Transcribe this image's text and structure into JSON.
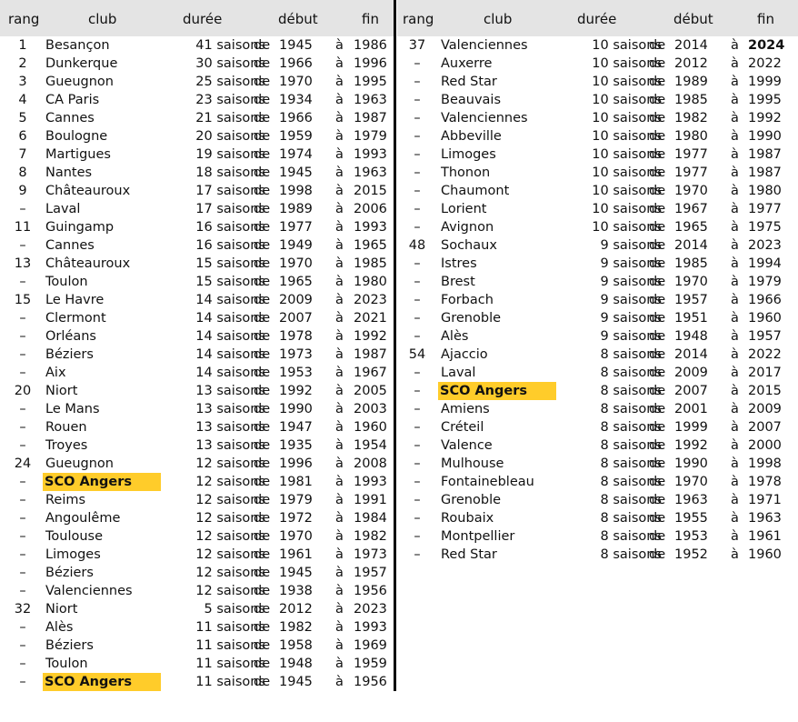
{
  "headers": {
    "rang": "rang",
    "club": "club",
    "duree": "durée",
    "debut": "début",
    "fin": "fin"
  },
  "connectors": {
    "de": "de",
    "a": "à"
  },
  "highlight_color": "#ffcc2a",
  "header_bg": "#e4e4e4",
  "left_rows": [
    {
      "rang": "1",
      "club": "Besançon",
      "duree": "41 saisons",
      "debut": "1945",
      "fin": "1986"
    },
    {
      "rang": "2",
      "club": "Dunkerque",
      "duree": "30 saisons",
      "debut": "1966",
      "fin": "1996"
    },
    {
      "rang": "3",
      "club": "Gueugnon",
      "duree": "25 saisons",
      "debut": "1970",
      "fin": "1995"
    },
    {
      "rang": "4",
      "club": "CA Paris",
      "duree": "23 saisons",
      "debut": "1934",
      "fin": "1963"
    },
    {
      "rang": "5",
      "club": "Cannes",
      "duree": "21 saisons",
      "debut": "1966",
      "fin": "1987"
    },
    {
      "rang": "6",
      "club": "Boulogne",
      "duree": "20 saisons",
      "debut": "1959",
      "fin": "1979"
    },
    {
      "rang": "7",
      "club": "Martigues",
      "duree": "19 saisons",
      "debut": "1974",
      "fin": "1993"
    },
    {
      "rang": "8",
      "club": "Nantes",
      "duree": "18 saisons",
      "debut": "1945",
      "fin": "1963"
    },
    {
      "rang": "9",
      "club": "Châteauroux",
      "duree": "17 saisons",
      "debut": "1998",
      "fin": "2015"
    },
    {
      "rang": "–",
      "club": "Laval",
      "duree": "17 saisons",
      "debut": "1989",
      "fin": "2006"
    },
    {
      "rang": "11",
      "club": "Guingamp",
      "duree": "16 saisons",
      "debut": "1977",
      "fin": "1993"
    },
    {
      "rang": "–",
      "club": "Cannes",
      "duree": "16 saisons",
      "debut": "1949",
      "fin": "1965"
    },
    {
      "rang": "13",
      "club": "Châteauroux",
      "duree": "15 saisons",
      "debut": "1970",
      "fin": "1985"
    },
    {
      "rang": "–",
      "club": "Toulon",
      "duree": "15 saisons",
      "debut": "1965",
      "fin": "1980"
    },
    {
      "rang": "15",
      "club": "Le Havre",
      "duree": "14 saisons",
      "debut": "2009",
      "fin": "2023"
    },
    {
      "rang": "–",
      "club": "Clermont",
      "duree": "14 saisons",
      "debut": "2007",
      "fin": "2021"
    },
    {
      "rang": "–",
      "club": "Orléans",
      "duree": "14 saisons",
      "debut": "1978",
      "fin": "1992"
    },
    {
      "rang": "–",
      "club": "Béziers",
      "duree": "14 saisons",
      "debut": "1973",
      "fin": "1987"
    },
    {
      "rang": "–",
      "club": "Aix",
      "duree": "14 saisons",
      "debut": "1953",
      "fin": "1967"
    },
    {
      "rang": "20",
      "club": "Niort",
      "duree": "13 saisons",
      "debut": "1992",
      "fin": "2005"
    },
    {
      "rang": "–",
      "club": "Le Mans",
      "duree": "13 saisons",
      "debut": "1990",
      "fin": "2003"
    },
    {
      "rang": "–",
      "club": "Rouen",
      "duree": "13 saisons",
      "debut": "1947",
      "fin": "1960"
    },
    {
      "rang": "–",
      "club": "Troyes",
      "duree": "13 saisons",
      "debut": "1935",
      "fin": "1954"
    },
    {
      "rang": "24",
      "club": "Gueugnon",
      "duree": "12 saisons",
      "debut": "1996",
      "fin": "2008"
    },
    {
      "rang": "–",
      "club": "SCO Angers",
      "duree": "12 saisons",
      "debut": "1981",
      "fin": "1993",
      "highlight": true
    },
    {
      "rang": "–",
      "club": "Reims",
      "duree": "12 saisons",
      "debut": "1979",
      "fin": "1991"
    },
    {
      "rang": "–",
      "club": "Angoulême",
      "duree": "12 saisons",
      "debut": "1972",
      "fin": "1984"
    },
    {
      "rang": "–",
      "club": "Toulouse",
      "duree": "12 saisons",
      "debut": "1970",
      "fin": "1982"
    },
    {
      "rang": "–",
      "club": "Limoges",
      "duree": "12 saisons",
      "debut": "1961",
      "fin": "1973"
    },
    {
      "rang": "–",
      "club": "Béziers",
      "duree": "12 saisons",
      "debut": "1945",
      "fin": "1957"
    },
    {
      "rang": "–",
      "club": "Valenciennes",
      "duree": "12 saisons",
      "debut": "1938",
      "fin": "1956"
    },
    {
      "rang": "32",
      "club": "Niort",
      "duree": "5 saisons",
      "debut": "2012",
      "fin": "2023"
    },
    {
      "rang": "–",
      "club": "Alès",
      "duree": "11 saisons",
      "debut": "1982",
      "fin": "1993"
    },
    {
      "rang": "–",
      "club": "Béziers",
      "duree": "11 saisons",
      "debut": "1958",
      "fin": "1969"
    },
    {
      "rang": "–",
      "club": "Toulon",
      "duree": "11 saisons",
      "debut": "1948",
      "fin": "1959"
    },
    {
      "rang": "–",
      "club": "SCO Angers",
      "duree": "11 saisons",
      "debut": "1945",
      "fin": "1956",
      "highlight": true
    }
  ],
  "right_rows": [
    {
      "rang": "37",
      "club": "Valenciennes",
      "duree": "10 saisons",
      "debut": "2014",
      "fin": "2024",
      "fin_bold": true
    },
    {
      "rang": "–",
      "club": "Auxerre",
      "duree": "10 saisons",
      "debut": "2012",
      "fin": "2022"
    },
    {
      "rang": "–",
      "club": "Red Star",
      "duree": "10 saisons",
      "debut": "1989",
      "fin": "1999"
    },
    {
      "rang": "–",
      "club": "Beauvais",
      "duree": "10 saisons",
      "debut": "1985",
      "fin": "1995"
    },
    {
      "rang": "–",
      "club": "Valenciennes",
      "duree": "10 saisons",
      "debut": "1982",
      "fin": "1992"
    },
    {
      "rang": "–",
      "club": "Abbeville",
      "duree": "10 saisons",
      "debut": "1980",
      "fin": "1990"
    },
    {
      "rang": "–",
      "club": "Limoges",
      "duree": "10 saisons",
      "debut": "1977",
      "fin": "1987"
    },
    {
      "rang": "–",
      "club": "Thonon",
      "duree": "10 saisons",
      "debut": "1977",
      "fin": "1987"
    },
    {
      "rang": "–",
      "club": "Chaumont",
      "duree": "10 saisons",
      "debut": "1970",
      "fin": "1980"
    },
    {
      "rang": "–",
      "club": "Lorient",
      "duree": "10 saisons",
      "debut": "1967",
      "fin": "1977"
    },
    {
      "rang": "–",
      "club": "Avignon",
      "duree": "10 saisons",
      "debut": "1965",
      "fin": "1975"
    },
    {
      "rang": "48",
      "club": "Sochaux",
      "duree": "9 saisons",
      "debut": "2014",
      "fin": "2023"
    },
    {
      "rang": "–",
      "club": "Istres",
      "duree": "9 saisons",
      "debut": "1985",
      "fin": "1994"
    },
    {
      "rang": "–",
      "club": "Brest",
      "duree": "9 saisons",
      "debut": "1970",
      "fin": "1979"
    },
    {
      "rang": "–",
      "club": "Forbach",
      "duree": "9 saisons",
      "debut": "1957",
      "fin": "1966"
    },
    {
      "rang": "–",
      "club": "Grenoble",
      "duree": "9 saisons",
      "debut": "1951",
      "fin": "1960"
    },
    {
      "rang": "–",
      "club": "Alès",
      "duree": "9 saisons",
      "debut": "1948",
      "fin": "1957"
    },
    {
      "rang": "54",
      "club": "Ajaccio",
      "duree": "8 saisons",
      "debut": "2014",
      "fin": "2022"
    },
    {
      "rang": "–",
      "club": "Laval",
      "duree": "8 saisons",
      "debut": "2009",
      "fin": "2017"
    },
    {
      "rang": "–",
      "club": "SCO Angers",
      "duree": "8 saisons",
      "debut": "2007",
      "fin": "2015",
      "highlight": true
    },
    {
      "rang": "–",
      "club": "Amiens",
      "duree": "8 saisons",
      "debut": "2001",
      "fin": "2009"
    },
    {
      "rang": "–",
      "club": "Créteil",
      "duree": "8 saisons",
      "debut": "1999",
      "fin": "2007"
    },
    {
      "rang": "–",
      "club": "Valence",
      "duree": "8 saisons",
      "debut": "1992",
      "fin": "2000"
    },
    {
      "rang": "–",
      "club": "Mulhouse",
      "duree": "8 saisons",
      "debut": "1990",
      "fin": "1998"
    },
    {
      "rang": "–",
      "club": "Fontainebleau",
      "duree": "8 saisons",
      "debut": "1970",
      "fin": "1978"
    },
    {
      "rang": "–",
      "club": "Grenoble",
      "duree": "8 saisons",
      "debut": "1963",
      "fin": "1971"
    },
    {
      "rang": "–",
      "club": "Roubaix",
      "duree": "8 saisons",
      "debut": "1955",
      "fin": "1963"
    },
    {
      "rang": "–",
      "club": "Montpellier",
      "duree": "8 saisons",
      "debut": "1953",
      "fin": "1961"
    },
    {
      "rang": "–",
      "club": "Red Star",
      "duree": "8 saisons",
      "debut": "1952",
      "fin": "1960"
    }
  ]
}
